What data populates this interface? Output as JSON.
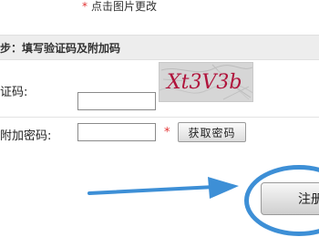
{
  "top_hint": {
    "star": "*",
    "text": "点击图片更改"
  },
  "step": {
    "title": "步：填写验证码及附加码"
  },
  "form": {
    "captcha_label": "证码:",
    "extra_label": "附加密码:",
    "extra_required_star": "*",
    "get_code_button": "获取密码"
  },
  "captcha": {
    "text": "Xt3V3b"
  },
  "actions": {
    "register_label": "注册"
  },
  "colors": {
    "accent_blue": "#3d8fd6",
    "required_red": "#e23232",
    "captcha_text": "#b0143c"
  }
}
